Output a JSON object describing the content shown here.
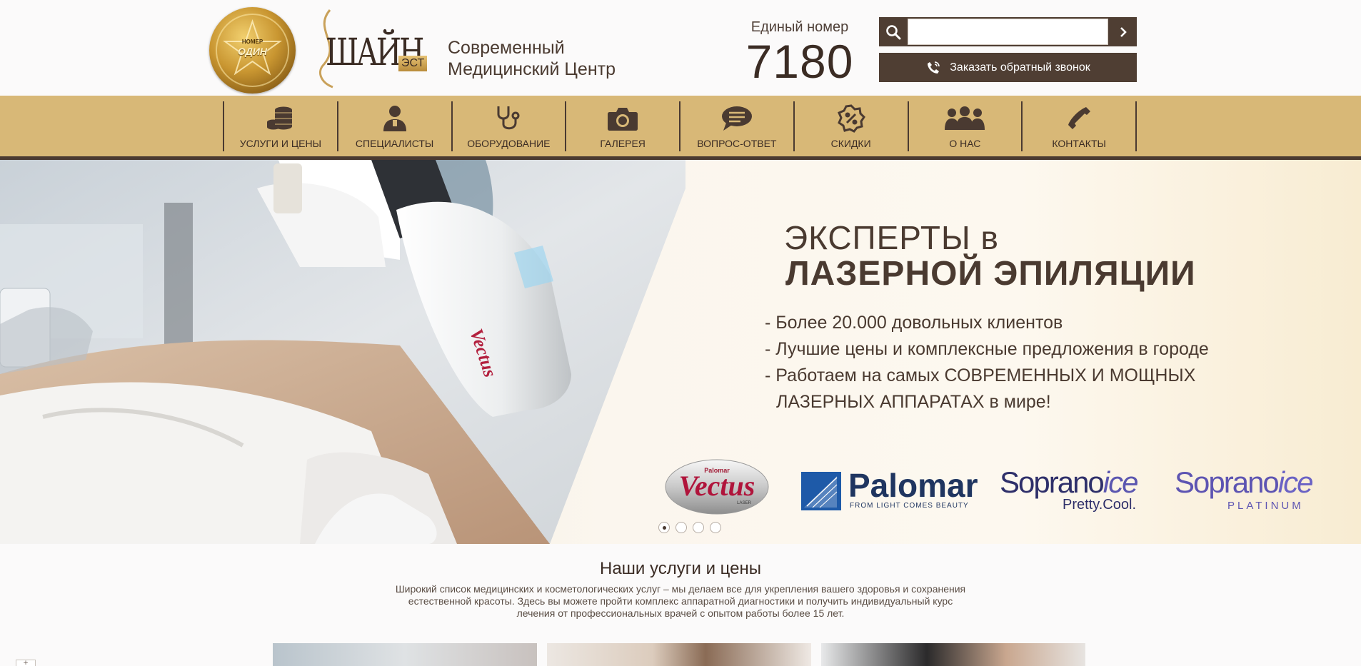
{
  "header": {
    "medal": {
      "top_text": "НОМЕР",
      "main_text": "ОДИН"
    },
    "brand": {
      "name": "ШАЙН",
      "suffix": "ЭСТ"
    },
    "tagline": [
      "Современный",
      "Медицинский Центр"
    ],
    "phone_label": "Единый номер",
    "phone_number": "7180",
    "search": {
      "value": "",
      "placeholder": ""
    },
    "callback_label": "Заказать обратный звонок",
    "colors": {
      "dark_brown": "#4f3e33",
      "gold": "#d8b877"
    }
  },
  "nav": {
    "items": [
      {
        "label": "УСЛУГИ И ЦЕНЫ",
        "icon": "coins-icon"
      },
      {
        "label": "СПЕЦИАЛИСТЫ",
        "icon": "doctor-icon"
      },
      {
        "label": "ОБОРУДОВАНИЕ",
        "icon": "stethoscope-icon"
      },
      {
        "label": "ГАЛЕРЕЯ",
        "icon": "camera-icon"
      },
      {
        "label": "ВОПРОС-ОТВЕТ",
        "icon": "chat-bubble-icon"
      },
      {
        "label": "СКИДКИ",
        "icon": "discount-badge-icon"
      },
      {
        "label": "О НАС",
        "icon": "group-icon"
      },
      {
        "label": "КОНТАКТЫ",
        "icon": "phone-icon"
      }
    ]
  },
  "hero": {
    "title_line1": "ЭКСПЕРТЫ в",
    "title_line2": "ЛАЗЕРНОЙ ЭПИЛЯЦИИ",
    "bullets": [
      "- Более 20.000 довольных клиентов",
      "- Лучшие цены и комплексные предложения в городе",
      "- Работаем на самых СОВРЕМЕННЫХ И МОЩНЫХ",
      "ЛАЗЕРНЫХ АППАРАТАХ в мире!"
    ],
    "device_brand": "Vectus",
    "brands": {
      "vectus": {
        "top": "Palomar",
        "name": "Vectus",
        "sub": "LASER"
      },
      "palomar": {
        "name": "Palomar",
        "sub": "FROM LIGHT COMES BEAUTY"
      },
      "soprano1": {
        "name": "Soprano",
        "ice": "ice",
        "sub": "Pretty.Cool."
      },
      "soprano2": {
        "name": "Soprano",
        "ice": "ice",
        "sub": "PLATINUM"
      }
    },
    "slides": 4,
    "active_slide": 1
  },
  "services": {
    "title": "Наши услуги и цены",
    "description": "Широкий список медицинских и косметологических услуг – мы делаем все для укрепления вашего здоровья и сохранения естественной красоты. Здесь вы можете пройти комплекс аппаратной диагностики и получить индивидуальный курс лечения от профессиональных врачей с опытом работы более 15 лет."
  },
  "corner_button_label": "+"
}
